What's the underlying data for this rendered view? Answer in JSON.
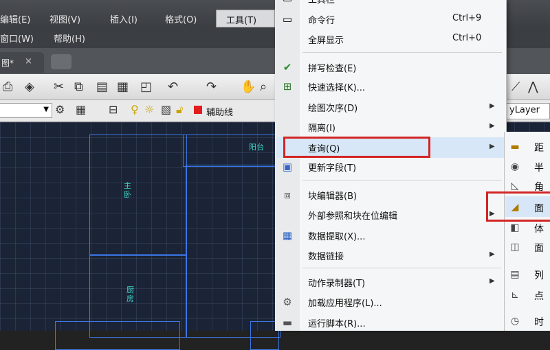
{
  "menubar": {
    "items": [
      "编辑(E)",
      "视图(V)",
      "插入(I)",
      "格式(O)",
      "工具(T)"
    ],
    "row2": [
      "窗口(W)",
      "帮助(H)"
    ]
  },
  "tab": {
    "title": "图*",
    "close": "×"
  },
  "toolbar": {
    "layer_name": "辅助线",
    "bylayer": "yLayer"
  },
  "drawing": {
    "labels": [
      "主卧",
      "厨房",
      "阳台"
    ]
  },
  "tools_menu": {
    "items": [
      {
        "label": "工具栏",
        "shortcut": "",
        "icon": "toolbar-icon"
      },
      {
        "label": "命令行",
        "shortcut": "Ctrl+9",
        "icon": "command-line-icon"
      },
      {
        "label": "全屏显示",
        "shortcut": "Ctrl+0",
        "icon": ""
      },
      {
        "label": "拼写检查(E)",
        "shortcut": "",
        "icon": "spell-check-icon"
      },
      {
        "label": "快速选择(K)...",
        "shortcut": "",
        "icon": "quick-select-icon"
      },
      {
        "label": "绘图次序(D)",
        "shortcut": "",
        "icon": "",
        "submenu": true
      },
      {
        "label": "隔离(I)",
        "shortcut": "",
        "icon": "",
        "submenu": true
      },
      {
        "label": "查询(Q)",
        "shortcut": "",
        "icon": "",
        "submenu": true
      },
      {
        "label": "更新字段(T)",
        "shortcut": "",
        "icon": "update-field-icon"
      },
      {
        "label": "块编辑器(B)",
        "shortcut": "",
        "icon": "block-editor-icon"
      },
      {
        "label": "外部参照和块在位编辑",
        "shortcut": "",
        "icon": "",
        "submenu": true
      },
      {
        "label": "数据提取(X)...",
        "shortcut": "",
        "icon": "data-extraction-icon"
      },
      {
        "label": "数据链接",
        "shortcut": "",
        "icon": "",
        "submenu": true
      },
      {
        "label": "动作录制器(T)",
        "shortcut": "",
        "icon": "",
        "submenu": true
      },
      {
        "label": "加载应用程序(L)...",
        "shortcut": "",
        "icon": "load-application-icon"
      },
      {
        "label": "运行脚本(R)...",
        "shortcut": "",
        "icon": "run-script-icon"
      }
    ],
    "arrow": "▶"
  },
  "query_submenu": {
    "items": [
      {
        "label": "距",
        "icon": "distance-icon"
      },
      {
        "label": "半",
        "icon": "radius-icon"
      },
      {
        "label": "角",
        "icon": "angle-icon"
      },
      {
        "label": "面",
        "icon": "area-icon"
      },
      {
        "label": "体",
        "icon": "volume-icon"
      },
      {
        "label": "面",
        "icon": "region-mass-icon"
      },
      {
        "label": "列",
        "icon": "list-icon"
      },
      {
        "label": "点",
        "icon": "id-point-icon"
      },
      {
        "label": "时",
        "icon": "time-icon"
      }
    ]
  },
  "colors": {
    "highlight": "#d7e7f7",
    "annotation_red": "#d32424",
    "canvas": "#1b2436"
  }
}
